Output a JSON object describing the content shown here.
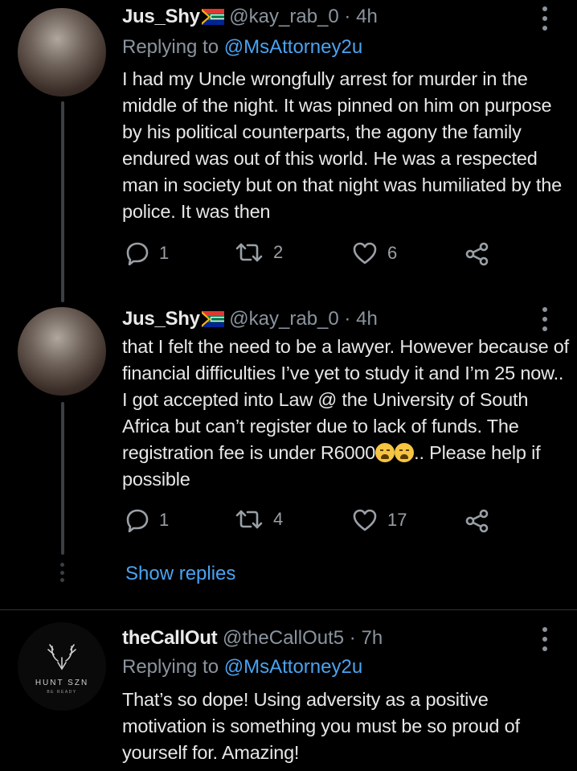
{
  "tweets": [
    {
      "name": "Jus_Shy",
      "handle": "@kay_rab_0",
      "separator": "·",
      "time": "4h",
      "replying_prefix": "Replying to ",
      "replying_to": "@MsAttorney2u",
      "text": "I had my Uncle wrongfully arrest for murder in the middle of the night. It was pinned on him on purpose by his political counterparts, the agony the family endured was out of this world. He was a respected man in society but on that night was humiliated by the police. It was then",
      "replies": "1",
      "retweets": "2",
      "likes": "6"
    },
    {
      "name": "Jus_Shy",
      "handle": "@kay_rab_0",
      "separator": "·",
      "time": "4h",
      "text_before_emoji": "that I felt the need to be a lawyer. However because of financial difficulties I’ve yet to study it and I’m 25 now.. I got accepted into Law @ the University of South Africa but can’t register due to lack of funds. The registration fee is under R6000",
      "text_after_emoji": ".. Please help if possible",
      "replies": "1",
      "retweets": "4",
      "likes": "17"
    },
    {
      "name": "theCallOut",
      "handle": "@theCallOut5",
      "separator": "·",
      "time": "7h",
      "replying_prefix": "Replying to ",
      "replying_to": "@MsAttorney2u",
      "text": "That’s so dope! Using adversity as a positive motivation is something you must be so proud of yourself for. Amazing!",
      "avatar_logo_text": "HUNT SZN",
      "avatar_logo_subtext": "BE READY"
    }
  ],
  "show_replies": "Show replies",
  "icons": {
    "reply": "reply-icon",
    "retweet": "retweet-icon",
    "like": "heart-icon",
    "share": "share-icon",
    "more": "more-vertical-icon",
    "flag": "south-africa-flag-icon",
    "emoji": "weary-face-emoji"
  },
  "colors": {
    "background": "#000000",
    "link": "#4aa3f0",
    "secondary_text": "#8b949e",
    "primary_text": "#e7e7e7"
  }
}
